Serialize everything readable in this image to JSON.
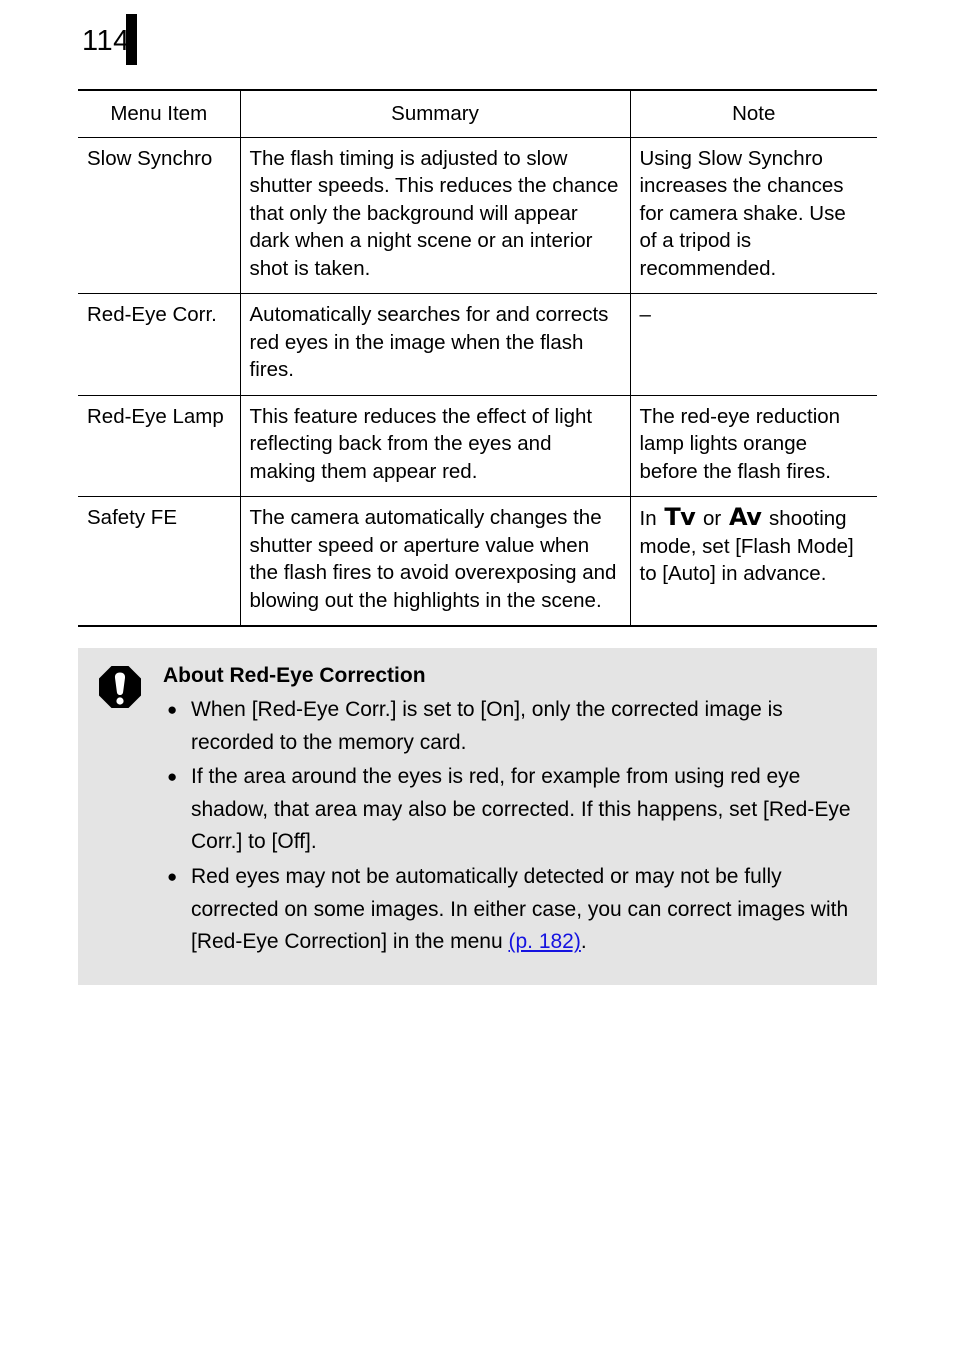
{
  "page": {
    "number": "114"
  },
  "table": {
    "headers": [
      "Menu Item",
      "Summary",
      "Note"
    ],
    "rows": [
      {
        "item": "Slow Synchro",
        "summary": "The flash timing is adjusted to slow shutter speeds. This reduces the chance that only the background will appear dark when a night scene or an interior shot is taken.",
        "note": "Using Slow Synchro increases the chances for camera shake. Use of a tripod is recommended."
      },
      {
        "item": "Red-Eye Corr.",
        "summary": "Automatically searches for and corrects red eyes in the image when the flash fires.",
        "note": "–"
      },
      {
        "item": "Red-Eye Lamp",
        "summary": "This feature reduces the effect of light reflecting back from the eyes and making them appear red.",
        "note": "The red-eye reduction lamp lights orange before the flash fires."
      },
      {
        "item": "Safety FE",
        "summary": "The camera automatically changes the shutter speed or aperture value when the flash fires to avoid overexposing and blowing out the highlights in the scene.",
        "note_prefix": "In",
        "note_mode_1": "Tv",
        "note_conjunction": "or",
        "note_mode_2": "Av",
        "note_suffix": "shooting mode, set [Flash Mode] to [Auto] in advance."
      }
    ]
  },
  "notice": {
    "title": "About Red-Eye Correction",
    "bullet_glyph": "●",
    "items": [
      {
        "text": "When [Red-Eye Corr.] is set to [On], only the corrected image is recorded to the memory card."
      },
      {
        "text": "If the area around the eyes is red, for example from using red eye shadow, that area may also be corrected. If this happens, set [Red-Eye Corr.] to [Off]."
      },
      {
        "text": "Red eyes may not be automatically detected or may not be fully corrected on some images. In either case, you can correct images with [Red-Eye Correction] in the menu ",
        "link": "(p. 182)",
        "after_link": "."
      }
    ]
  },
  "colors": {
    "notice_background": "#e4e4e4",
    "link": "#1513e0",
    "rule": "#000000"
  }
}
